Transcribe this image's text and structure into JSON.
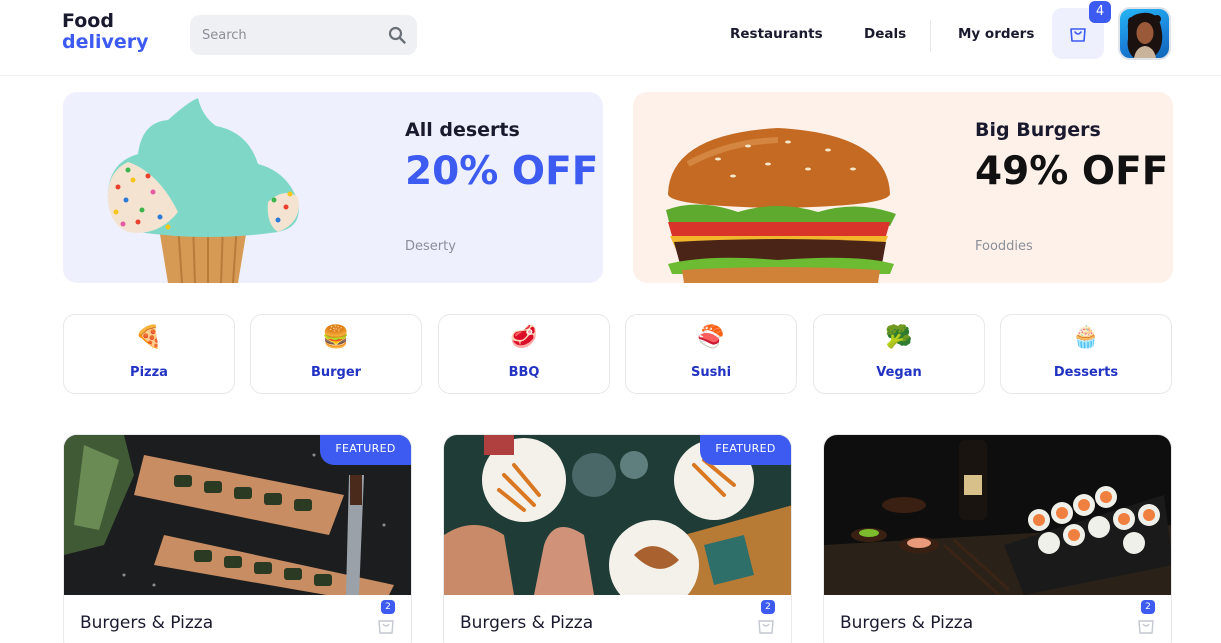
{
  "header": {
    "logo_line1": "Food",
    "logo_line2": "delivery",
    "search_placeholder": "Search",
    "nav": [
      "Restaurants",
      "Deals",
      "My orders"
    ],
    "cart_count": "4"
  },
  "promos": [
    {
      "title": "All deserts",
      "discount": "20% OFF",
      "subtitle": "Deserty",
      "image": "cupcake"
    },
    {
      "title": "Big Burgers",
      "discount": "49% OFF",
      "subtitle": "Fooddies",
      "image": "burger"
    }
  ],
  "categories": [
    {
      "label": "Pizza",
      "icon": "🍕"
    },
    {
      "label": "Burger",
      "icon": "🍔"
    },
    {
      "label": "BBQ",
      "icon": "🥩"
    },
    {
      "label": "Sushi",
      "icon": "🍣"
    },
    {
      "label": "Vegan",
      "icon": "🥦"
    },
    {
      "label": "Desserts",
      "icon": "🧁"
    }
  ],
  "cards": [
    {
      "title": "Burgers & Pizza",
      "featured": "FEATURED",
      "cart_count": "2",
      "image": "sushi-boards"
    },
    {
      "title": "Burgers & Pizza",
      "featured": "FEATURED",
      "cart_count": "2",
      "image": "table-fries"
    },
    {
      "title": "Burgers & Pizza",
      "featured": "",
      "cart_count": "2",
      "image": "sushi-rolls"
    }
  ],
  "colors": {
    "accent": "#3d5af1",
    "category_text": "#2233c4",
    "promo_left_bg": "#eef0fd",
    "promo_right_bg": "#fdf1ea"
  }
}
